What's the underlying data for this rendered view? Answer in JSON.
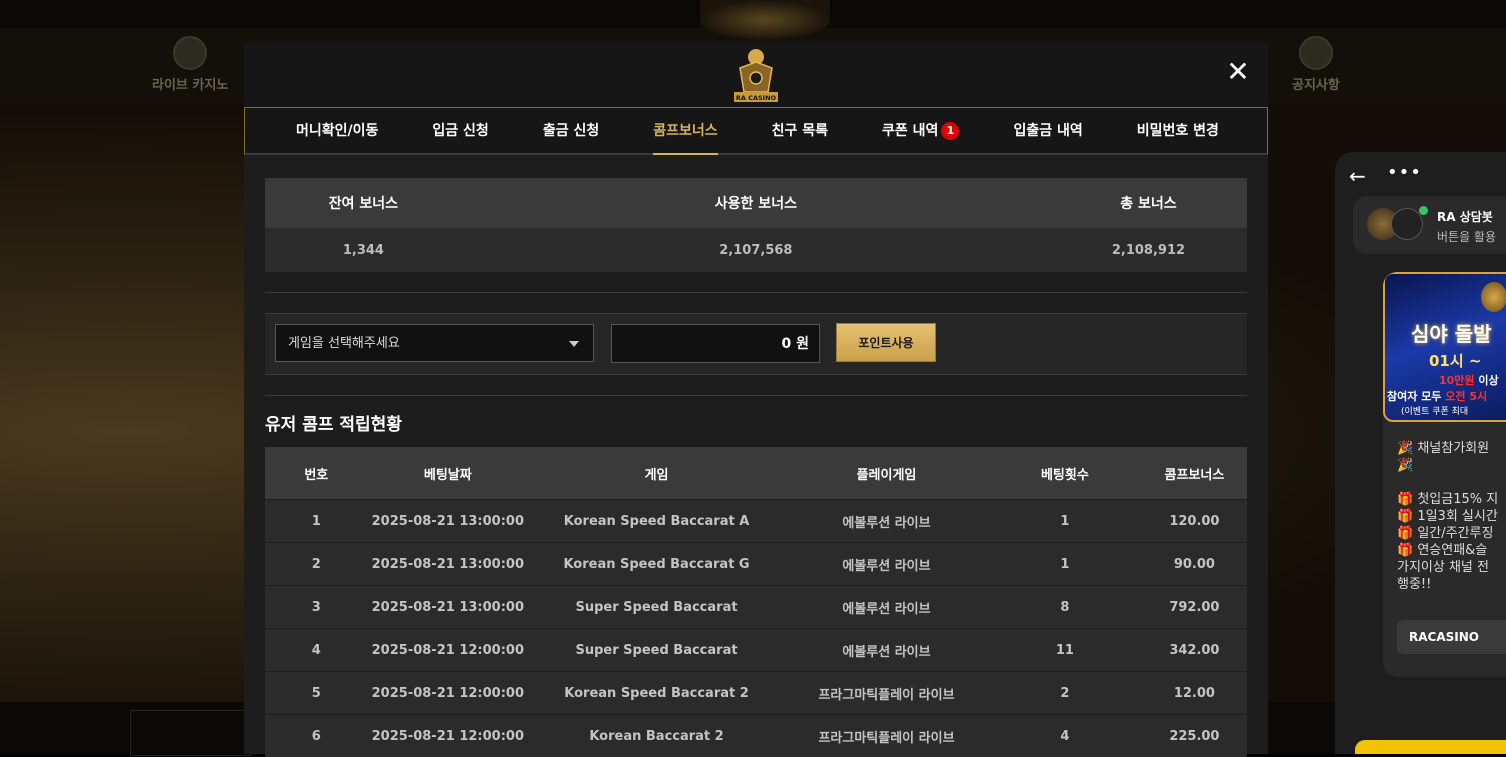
{
  "background": {
    "nav_items": [
      "라이브 카지노",
      "공지사항"
    ]
  },
  "modal": {
    "logo_text": "RA CASINO",
    "close_label": "✕",
    "tabs": [
      {
        "label": "머니확인/이동"
      },
      {
        "label": "입금 신청"
      },
      {
        "label": "출금 신청"
      },
      {
        "label": "콤프보너스",
        "active": true
      },
      {
        "label": "친구 목록"
      },
      {
        "label": "쿠폰 내역",
        "badge": "1"
      },
      {
        "label": "입출금 내역"
      },
      {
        "label": "비밀번호 변경"
      }
    ],
    "summary": {
      "headers": [
        "잔여 보너스",
        "사용한 보너스",
        "총 보너스"
      ],
      "values": [
        "1,344",
        "2,107,568",
        "2,108,912"
      ]
    },
    "use_form": {
      "select_placeholder": "게임을 선택해주세요",
      "amount_value": "0 원",
      "button_label": "포인트사용"
    },
    "section_title": "유저 콤프 적립현황",
    "list": {
      "headers": [
        "번호",
        "베팅날짜",
        "게임",
        "플레이게임",
        "베팅횟수",
        "콤프보너스"
      ],
      "rows": [
        [
          "1",
          "2025-08-21 13:00:00",
          "Korean Speed Baccarat A",
          "에볼루션 라이브",
          "1",
          "120.00"
        ],
        [
          "2",
          "2025-08-21 13:00:00",
          "Korean Speed Baccarat G",
          "에볼루션 라이브",
          "1",
          "90.00"
        ],
        [
          "3",
          "2025-08-21 13:00:00",
          "Super Speed Baccarat",
          "에볼루션 라이브",
          "8",
          "792.00"
        ],
        [
          "4",
          "2025-08-21 12:00:00",
          "Super Speed Baccarat",
          "에볼루션 라이브",
          "11",
          "342.00"
        ],
        [
          "5",
          "2025-08-21 12:00:00",
          "Korean Speed Baccarat 2",
          "프라그마틱플레이 라이브",
          "2",
          "12.00"
        ],
        [
          "6",
          "2025-08-21 12:00:00",
          "Korean Baccarat 2",
          "프라그마틱플레이 라이브",
          "4",
          "225.00"
        ]
      ]
    }
  },
  "chat": {
    "back_icon": "←",
    "menu_icon": "•••",
    "profile_name": "RA 상담봇",
    "profile_desc": "버튼을 활용",
    "banner": {
      "title": "심야 돌발",
      "time": "01시 ~",
      "line1_red": "10만원",
      "line1": " 이상",
      "line2": "참여자 모두 ",
      "line2_red": "오전 5시",
      "line3": "(이벤트 쿠폰 최대"
    },
    "message_lines": [
      "🎉 채널참가회원",
      "🎉",
      "",
      "🎁 첫입금15% 지",
      "🎁 1일3회 실시간",
      "🎁 일간/주간루징",
      "🎁 연승연패&슬",
      "가지이상 채널 전",
      "행중!!"
    ],
    "chip_label": "RACASINO"
  }
}
